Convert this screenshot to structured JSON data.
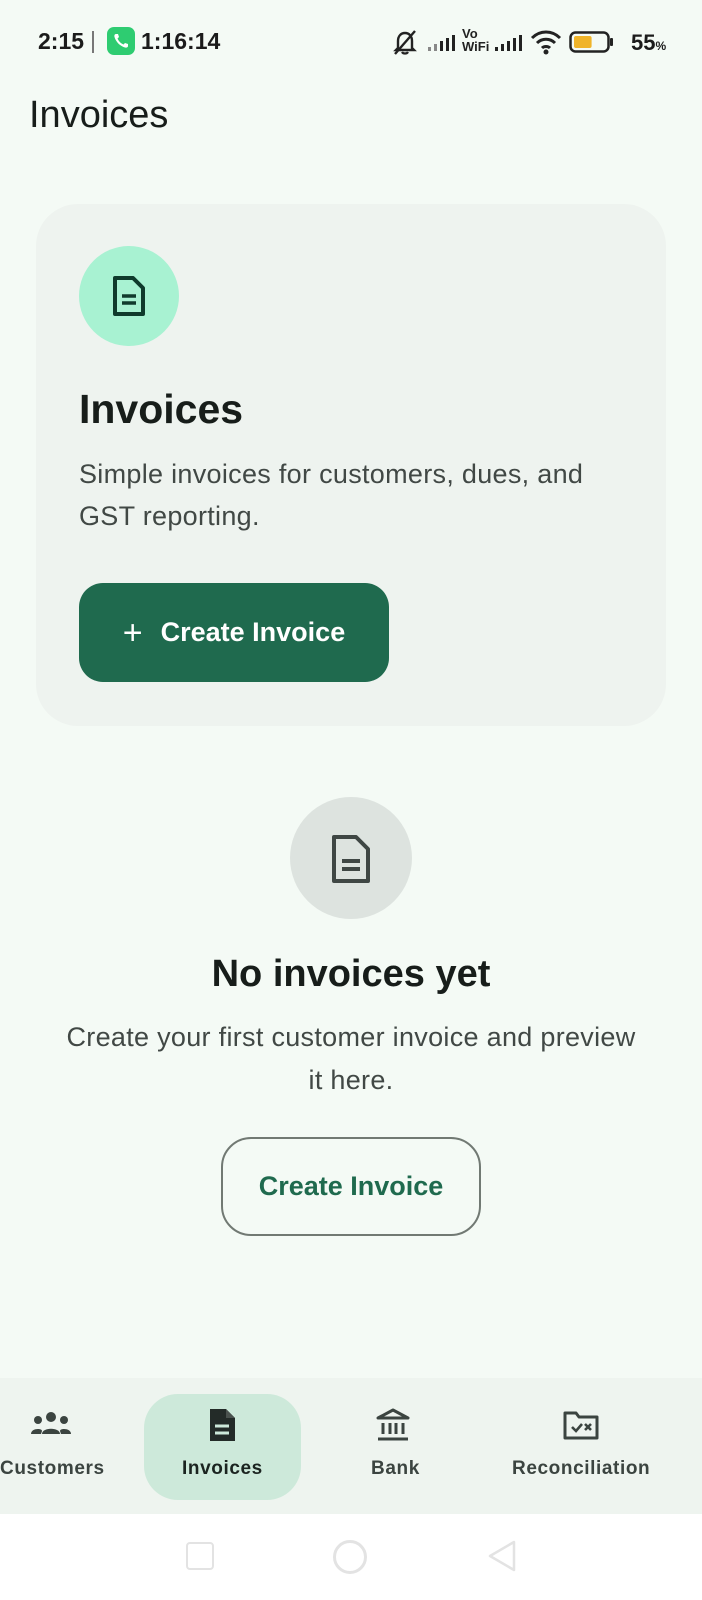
{
  "status_bar": {
    "time": "2:15",
    "call_timer": "1:16:14",
    "battery_percent": "55",
    "battery_unit": "%",
    "network_label_top": "Vo",
    "network_label_bottom": "WiFi",
    "battery_level": 0.55,
    "battery_color": "#f0b429"
  },
  "header": {
    "title": "Invoices"
  },
  "hero": {
    "title": "Invoices",
    "description": "Simple invoices for customers, dues, and GST reporting.",
    "button_icon": "+",
    "button_label": "Create Invoice",
    "icon": "document-icon"
  },
  "empty_state": {
    "title": "No invoices yet",
    "description": "Create your first customer invoice and preview it here.",
    "button_label": "Create Invoice",
    "icon": "document-icon"
  },
  "bottom_nav": {
    "items": [
      {
        "label": "Customers",
        "icon": "people-icon",
        "active": false
      },
      {
        "label": "Invoices",
        "icon": "document-icon",
        "active": true
      },
      {
        "label": "Bank",
        "icon": "bank-icon",
        "active": false
      },
      {
        "label": "Reconciliation",
        "icon": "folder-check-icon",
        "active": false
      }
    ]
  },
  "colors": {
    "background": "#f4faf5",
    "primary": "#1f6a4e",
    "hero_icon_bg": "#a8f2d2",
    "active_nav_pill": "#cde9da"
  }
}
